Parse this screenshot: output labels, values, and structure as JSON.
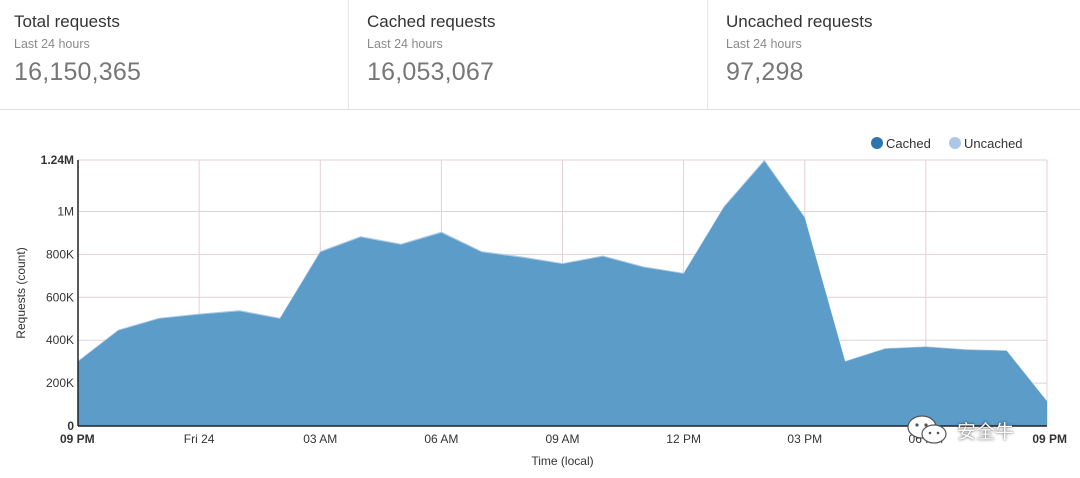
{
  "stats": [
    {
      "title": "Total requests",
      "subtitle": "Last 24 hours",
      "value": "16,150,365"
    },
    {
      "title": "Cached requests",
      "subtitle": "Last 24 hours",
      "value": "16,053,067"
    },
    {
      "title": "Uncached requests",
      "subtitle": "Last 24 hours",
      "value": "97,298"
    }
  ],
  "chart_data": {
    "type": "area",
    "stacked": true,
    "xlabel": "Time (local)",
    "ylabel": "Requests (count)",
    "ylim": [
      0,
      1240000
    ],
    "yticks": [
      0,
      200000,
      400000,
      600000,
      800000,
      1000000,
      1240000
    ],
    "ytick_labels": [
      "0",
      "200K",
      "400K",
      "600K",
      "800K",
      "1M",
      "1.24M"
    ],
    "xtick_labels": [
      "09 PM",
      "Fri 24",
      "03 AM",
      "06 AM",
      "09 AM",
      "12 PM",
      "03 PM",
      "06 PM",
      "09 PM"
    ],
    "x": [
      "09 PM",
      "10 PM",
      "11 PM",
      "12 AM",
      "01 AM",
      "02 AM",
      "03 AM",
      "04 AM",
      "05 AM",
      "06 AM",
      "07 AM",
      "08 AM",
      "09 AM",
      "10 AM",
      "11 AM",
      "12 PM",
      "01 PM",
      "02 PM",
      "03 PM",
      "04 PM",
      "05 PM",
      "06 PM",
      "07 PM",
      "08 PM",
      "09 PM"
    ],
    "series": [
      {
        "name": "Cached",
        "color": "#5b9cc9",
        "values": [
          300000,
          445000,
          500000,
          520000,
          535000,
          500000,
          810000,
          880000,
          845000,
          900000,
          810000,
          785000,
          755000,
          790000,
          740000,
          710000,
          1020000,
          1235000,
          970000,
          300000,
          360000,
          368000,
          355000,
          350000,
          115000
        ]
      },
      {
        "name": "Uncached",
        "color": "#adc8e6",
        "values": [
          4000,
          4000,
          4000,
          4000,
          5000,
          4000,
          5000,
          5000,
          5000,
          6000,
          5000,
          5000,
          4000,
          5000,
          4000,
          4000,
          5000,
          6000,
          5000,
          3000,
          3000,
          3000,
          3000,
          3000,
          2000
        ]
      }
    ],
    "grid": true,
    "legend_position": "top-right"
  },
  "watermark": {
    "text": "安全牛"
  }
}
